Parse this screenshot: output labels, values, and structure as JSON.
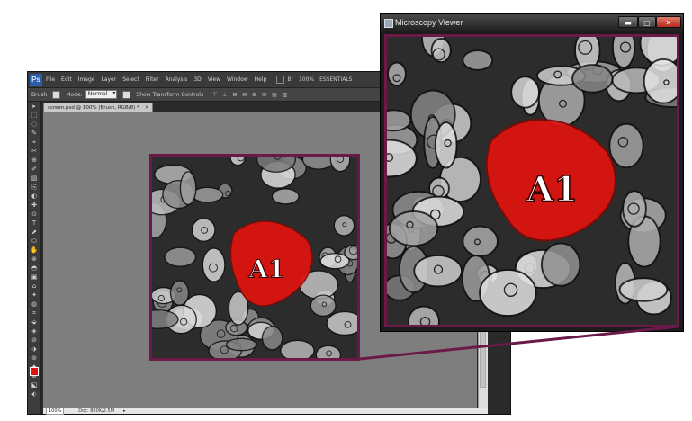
{
  "editor": {
    "app_logo": "Ps",
    "menu": [
      "File",
      "Edit",
      "Image",
      "Layer",
      "Select",
      "Filter",
      "Analysis",
      "3D",
      "View",
      "Window",
      "Help"
    ],
    "menubar_extras": [
      "Br",
      "100%",
      "ESSENTIALS"
    ],
    "options": {
      "tool_preset": "Brush",
      "mode_label": "Mode:",
      "mode_value": "Normal",
      "transform_label": "Show Transform Controls",
      "align_icons": "⊤ ⊥ ⊞ ⊟ ⊠ ⊡ ▤ ▥"
    },
    "tools": [
      "▸",
      "⬚",
      "◌",
      "✎",
      "⌖",
      "✂",
      "⊕",
      "✐",
      "▨",
      "⎘",
      "◐",
      "✚",
      "⊙",
      "T",
      "⬈",
      "⬭",
      "✋",
      "⊗",
      "◓",
      "▣",
      "⌂",
      "✦",
      "◍",
      "⌗",
      "⬙",
      "◈",
      "⊘",
      "⬗",
      "⊚",
      "⬘",
      "⊛",
      "⬕",
      "⬖"
    ],
    "document_tab": "screen.psd @ 100% (Brush, RGB/8) *",
    "document_tab_close": "×",
    "status": {
      "zoom": "100%",
      "info": "Doc: 880K/2.5M",
      "arrow": "▸"
    }
  },
  "viewer": {
    "title": "Microscopy Viewer",
    "buttons": {
      "minimize": "▬",
      "maximize": "▢",
      "close": "✕"
    }
  },
  "annotation": {
    "label": "A1",
    "fill_color": "#e0140f",
    "border_color": "#6b1a48"
  }
}
